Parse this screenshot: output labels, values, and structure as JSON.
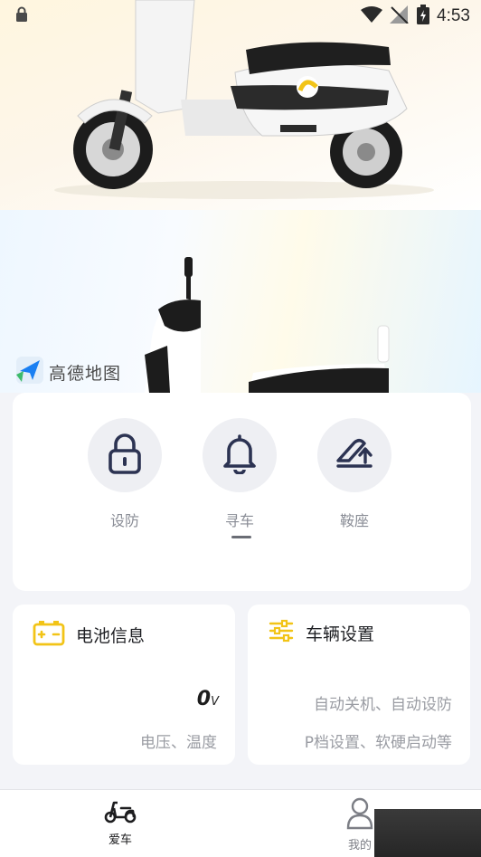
{
  "status_bar": {
    "time": "4:53",
    "icons": [
      "lock-icon",
      "wifi-icon",
      "signal-icon",
      "battery-icon"
    ]
  },
  "hero": {
    "map_provider": "高德地图"
  },
  "controls": {
    "buttons": [
      {
        "label": "设防",
        "icon": "lock-icon"
      },
      {
        "label": "寻车",
        "icon": "bell-icon"
      },
      {
        "label": "鞍座",
        "icon": "seat-icon"
      }
    ]
  },
  "battery_card": {
    "title": "电池信息",
    "value": "0",
    "unit": "V",
    "subtitle": "电压、温度",
    "icon": "battery-icon"
  },
  "settings_card": {
    "title": "车辆设置",
    "line1": "自动关机、自动设防",
    "line2": "P档设置、软硬启动等",
    "icon": "sliders-icon"
  },
  "bottom_nav": {
    "items": [
      {
        "label": "爱车",
        "icon": "scooter-icon",
        "active": true
      },
      {
        "label": "我的",
        "icon": "person-icon",
        "active": false
      }
    ]
  },
  "colors": {
    "accent_yellow": "#f2c417",
    "icon_dark": "#2c3352",
    "background": "#f3f4f8"
  }
}
